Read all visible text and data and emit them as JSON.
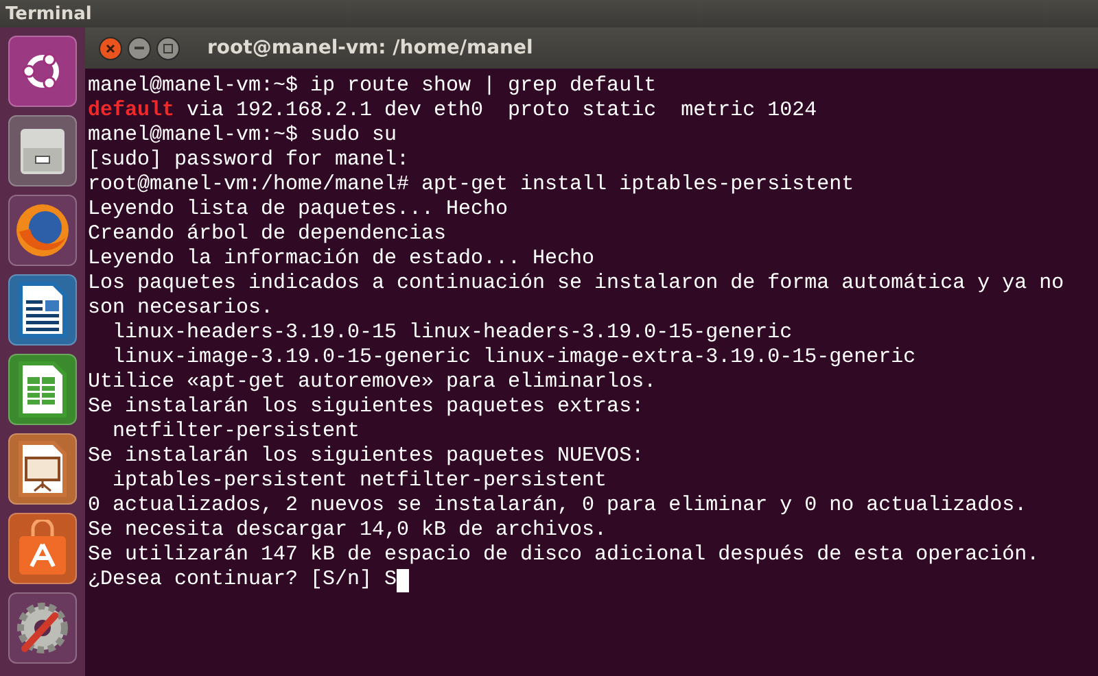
{
  "top_bar": {
    "title": "Terminal"
  },
  "window": {
    "title": "root@manel-vm: /home/manel"
  },
  "terminal": {
    "lines": [
      [
        {
          "text": "manel@manel-vm:~$ ip route show | grep default",
          "kind": "plain"
        }
      ],
      [
        {
          "text": "default",
          "kind": "match"
        },
        {
          "text": " via 192.168.2.1 dev eth0  proto static  metric 1024",
          "kind": "plain"
        }
      ],
      [
        {
          "text": "manel@manel-vm:~$ sudo su",
          "kind": "plain"
        }
      ],
      [
        {
          "text": "[sudo] password for manel:",
          "kind": "plain"
        }
      ],
      [
        {
          "text": "root@manel-vm:/home/manel# apt-get install iptables-persistent",
          "kind": "plain"
        }
      ],
      [
        {
          "text": "Leyendo lista de paquetes... Hecho",
          "kind": "plain"
        }
      ],
      [
        {
          "text": "Creando árbol de dependencias",
          "kind": "plain"
        }
      ],
      [
        {
          "text": "Leyendo la información de estado... Hecho",
          "kind": "plain"
        }
      ],
      [
        {
          "text": "Los paquetes indicados a continuación se instalaron de forma automática y ya no",
          "kind": "plain"
        }
      ],
      [
        {
          "text": "son necesarios.",
          "kind": "plain"
        }
      ],
      [
        {
          "text": "  linux-headers-3.19.0-15 linux-headers-3.19.0-15-generic",
          "kind": "plain"
        }
      ],
      [
        {
          "text": "  linux-image-3.19.0-15-generic linux-image-extra-3.19.0-15-generic",
          "kind": "plain"
        }
      ],
      [
        {
          "text": "Utilice «apt-get autoremove» para eliminarlos.",
          "kind": "plain"
        }
      ],
      [
        {
          "text": "Se instalarán los siguientes paquetes extras:",
          "kind": "plain"
        }
      ],
      [
        {
          "text": "  netfilter-persistent",
          "kind": "plain"
        }
      ],
      [
        {
          "text": "Se instalarán los siguientes paquetes NUEVOS:",
          "kind": "plain"
        }
      ],
      [
        {
          "text": "  iptables-persistent netfilter-persistent",
          "kind": "plain"
        }
      ],
      [
        {
          "text": "0 actualizados, 2 nuevos se instalarán, 0 para eliminar y 0 no actualizados.",
          "kind": "plain"
        }
      ],
      [
        {
          "text": "Se necesita descargar 14,0 kB de archivos.",
          "kind": "plain"
        }
      ],
      [
        {
          "text": "Se utilizarán 147 kB de espacio de disco adicional después de esta operación.",
          "kind": "plain"
        }
      ],
      [
        {
          "text": "¿Desea continuar? [S/n] S",
          "kind": "plain"
        }
      ]
    ],
    "cursor": true
  }
}
